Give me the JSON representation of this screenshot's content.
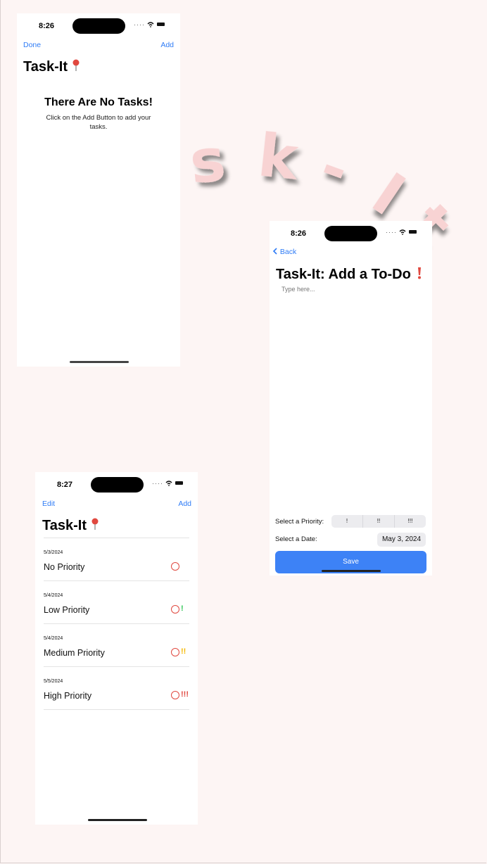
{
  "banner": {
    "text": "Task-It",
    "color": "#f8d3d3"
  },
  "screen_empty": {
    "time": "8:26",
    "left_action": "Done",
    "right_action": "Add",
    "title": "Task-It",
    "title_icon": "pushpin-icon",
    "empty_title": "There Are No Tasks!",
    "empty_subtitle": "Click on the Add Button to add your tasks."
  },
  "screen_add": {
    "time": "8:26",
    "back_label": "Back",
    "title": "Task-It: Add a To-Do",
    "title_icon": "exclamation-icon",
    "placeholder": "Type here...",
    "priority_label": "Select a Priority:",
    "priority_options": [
      "!",
      "!!",
      "!!!"
    ],
    "date_label": "Select a Date:",
    "date_value": "May 3, 2024",
    "save_label": "Save"
  },
  "screen_list": {
    "time": "8:27",
    "left_action": "Edit",
    "right_action": "Add",
    "title": "Task-It",
    "title_icon": "pushpin-icon",
    "tasks": [
      {
        "date": "5/3/2024",
        "name": "No Priority",
        "priority": "",
        "priority_color": ""
      },
      {
        "date": "5/4/2024",
        "name": "Low Priority",
        "priority": "!",
        "priority_color": "#34c759"
      },
      {
        "date": "5/4/2024",
        "name": "Medium Priority",
        "priority": "!!",
        "priority_color": "#f5b800"
      },
      {
        "date": "5/5/2024",
        "name": "High Priority",
        "priority": "!!!",
        "priority_color": "#e0483f"
      }
    ]
  },
  "colors": {
    "accent": "#2f7cf6",
    "background": "#fdf5f4",
    "circle": "#e0483f",
    "save": "#3d82f6"
  }
}
